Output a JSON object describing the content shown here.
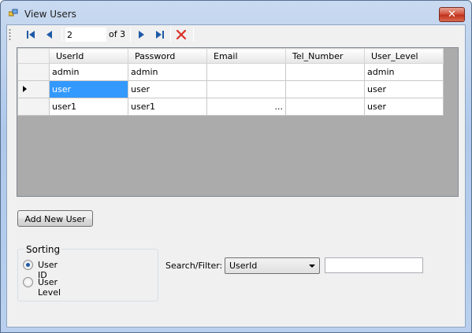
{
  "window": {
    "title": "View Users",
    "close_glyph": "✕"
  },
  "navigator": {
    "position": "2",
    "count_label": "of 3",
    "icons": [
      "move-first-icon",
      "move-previous-icon",
      "move-next-icon",
      "move-last-icon",
      "delete-icon"
    ]
  },
  "grid": {
    "columns": [
      "UserId",
      "Password",
      "Email",
      "Tel_Number",
      "User_Level"
    ],
    "rows": [
      {
        "UserId": "admin",
        "Password": "admin",
        "Email": "",
        "Tel_Number": "",
        "User_Level": "admin"
      },
      {
        "UserId": "user",
        "Password": "user",
        "Email": "",
        "Tel_Number": "",
        "User_Level": "user"
      },
      {
        "UserId": "user1",
        "Password": "user1",
        "Email": "...",
        "Tel_Number": "",
        "User_Level": "user"
      }
    ],
    "current_row": 2,
    "selection_color": "#3399ff"
  },
  "buttons": {
    "add_new_user": "Add New User"
  },
  "sorting": {
    "legend": "Sorting",
    "options": [
      {
        "label": "User ID",
        "checked": true
      },
      {
        "label": "User Level",
        "checked": false
      }
    ]
  },
  "filter": {
    "label": "Search/Filter:",
    "selected": "UserId",
    "value": ""
  }
}
